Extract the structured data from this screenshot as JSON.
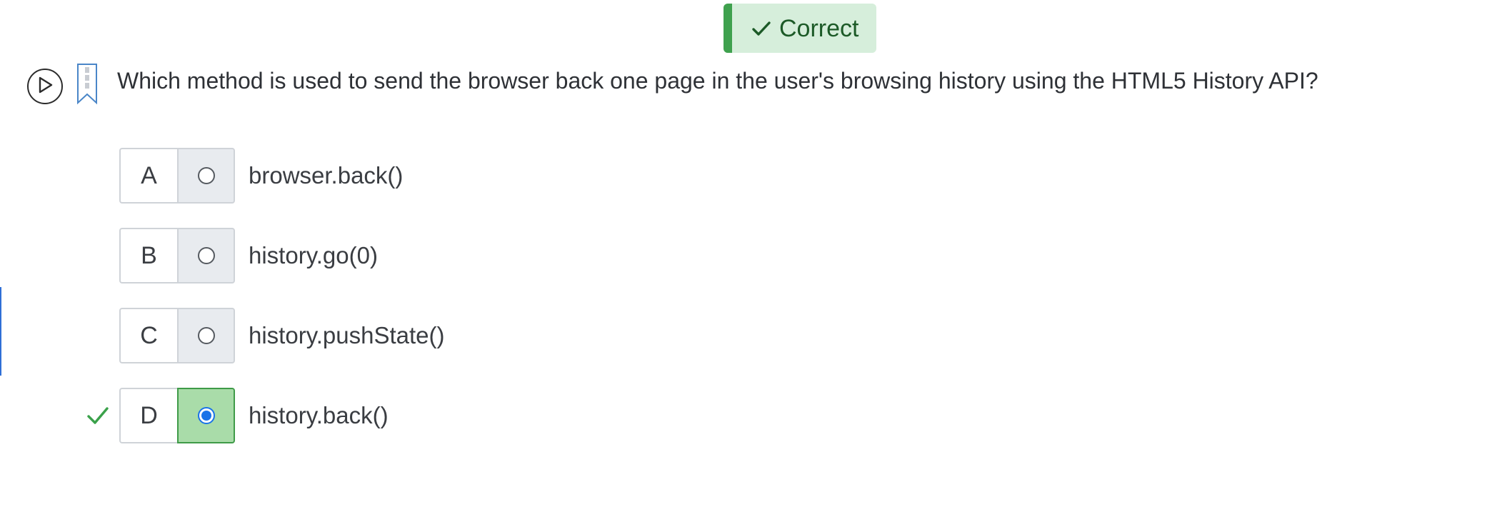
{
  "feedback": {
    "status_text": "Correct",
    "icon": "check-icon",
    "colors": {
      "background": "#d6eedb",
      "bar": "#3fa14e",
      "text": "#1c5a27"
    }
  },
  "question": {
    "text": "Which method is used to send the browser back one page in the user's browsing history using the HTML5 History API?",
    "play_icon": "play-icon",
    "bookmark_icon": "bookmark-icon"
  },
  "options": [
    {
      "letter": "A",
      "text": "browser.back()",
      "selected": false
    },
    {
      "letter": "B",
      "text": "history.go(0)",
      "selected": false
    },
    {
      "letter": "C",
      "text": "history.pushState()",
      "selected": false
    },
    {
      "letter": "D",
      "text": "history.back()",
      "selected": true,
      "correct": true
    }
  ],
  "colors": {
    "selected_fill": "#a9dca9",
    "selected_border": "#3f9b48",
    "radio_checked": "#1a73e8",
    "correct_check": "#3aa14a"
  }
}
